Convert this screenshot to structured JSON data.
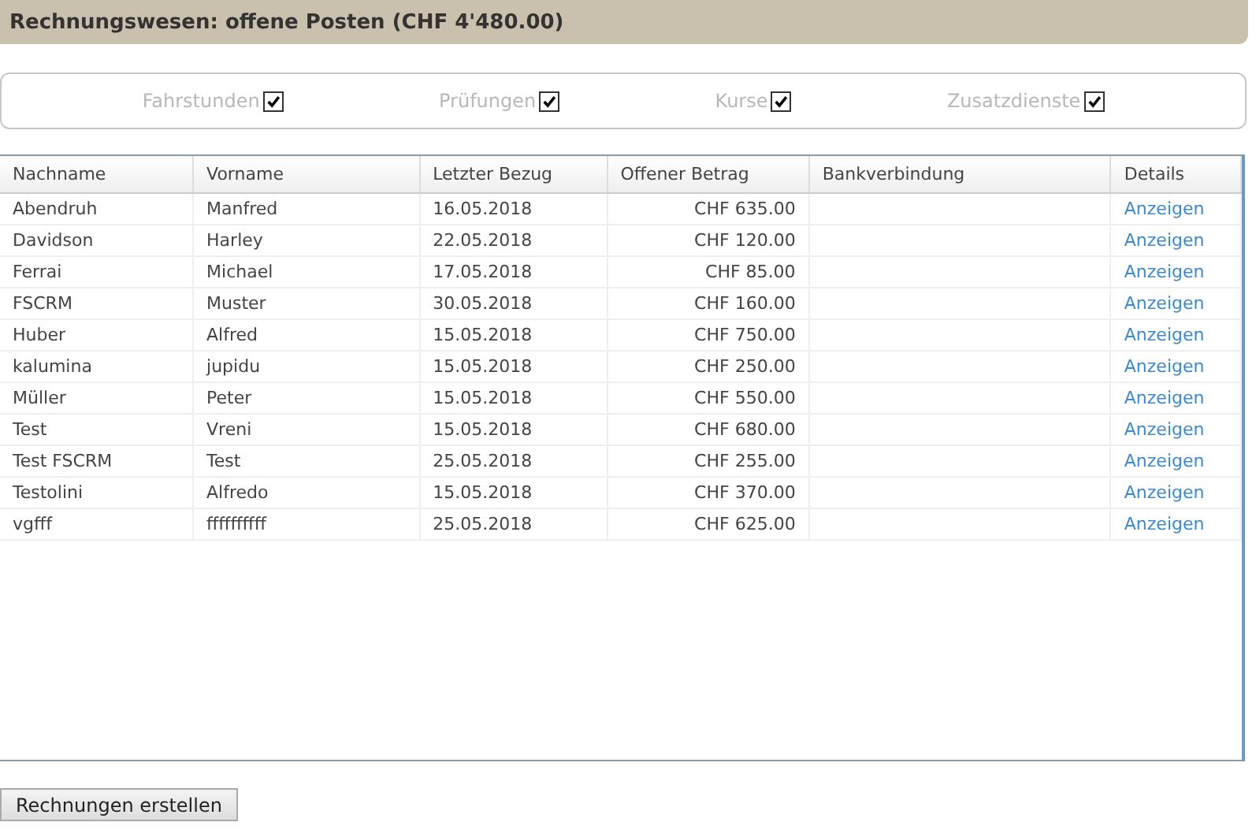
{
  "title": "Rechnungswesen: offene Posten (CHF 4'480.00)",
  "filters": [
    {
      "label": "Fahrstunden",
      "checked": true
    },
    {
      "label": "Prüfungen",
      "checked": true
    },
    {
      "label": "Kurse",
      "checked": true
    },
    {
      "label": "Zusatzdienste",
      "checked": true
    }
  ],
  "table": {
    "columns": [
      "Nachname",
      "Vorname",
      "Letzter Bezug",
      "Offener Betrag",
      "Bankverbindung",
      "Details"
    ],
    "rows": [
      [
        "Abendruh",
        "Manfred",
        "16.05.2018",
        "CHF 635.00",
        "",
        "Anzeigen"
      ],
      [
        "Davidson",
        "Harley",
        "22.05.2018",
        "CHF 120.00",
        "",
        "Anzeigen"
      ],
      [
        "Ferrai",
        "Michael",
        "17.05.2018",
        "CHF 85.00",
        "",
        "Anzeigen"
      ],
      [
        "FSCRM",
        "Muster",
        "30.05.2018",
        "CHF 160.00",
        "",
        "Anzeigen"
      ],
      [
        "Huber",
        "Alfred",
        "15.05.2018",
        "CHF 750.00",
        "",
        "Anzeigen"
      ],
      [
        "kalumina",
        "jupidu",
        "15.05.2018",
        "CHF 250.00",
        "",
        "Anzeigen"
      ],
      [
        "Müller",
        "Peter",
        "15.05.2018",
        "CHF 550.00",
        "",
        "Anzeigen"
      ],
      [
        "Test",
        "Vreni",
        "15.05.2018",
        "CHF 680.00",
        "",
        "Anzeigen"
      ],
      [
        "Test FSCRM",
        "Test",
        "25.05.2018",
        "CHF 255.00",
        "",
        "Anzeigen"
      ],
      [
        "Testolini",
        "Alfredo",
        "15.05.2018",
        "CHF 370.00",
        "",
        "Anzeigen"
      ],
      [
        "vgfff",
        "ffffffffff",
        "25.05.2018",
        "CHF 625.00",
        "",
        "Anzeigen"
      ]
    ]
  },
  "button": "Rechnungen erstellen"
}
